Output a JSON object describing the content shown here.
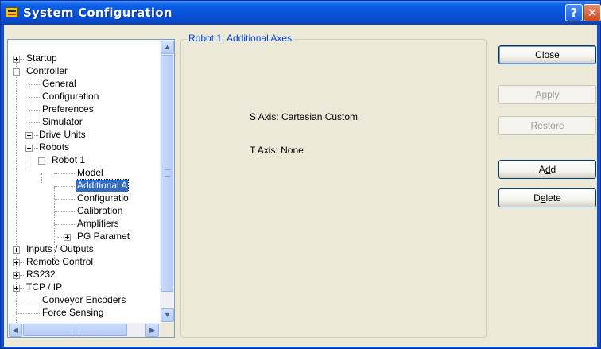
{
  "window": {
    "title": "System Configuration",
    "help_glyph": "?",
    "close_glyph": "✕"
  },
  "tree": {
    "nodes": [
      {
        "label": "Startup",
        "expander": "plus"
      },
      {
        "label": "Controller",
        "expander": "minus"
      },
      {
        "label": "General"
      },
      {
        "label": "Configuration"
      },
      {
        "label": "Preferences"
      },
      {
        "label": "Simulator"
      },
      {
        "label": "Drive Units",
        "expander": "plus"
      },
      {
        "label": "Robots",
        "expander": "minus"
      },
      {
        "label": "Robot 1",
        "expander": "minus"
      },
      {
        "label": "Model"
      },
      {
        "label": "Additional A",
        "selected": true
      },
      {
        "label": "Configuratio"
      },
      {
        "label": "Calibration"
      },
      {
        "label": "Amplifiers"
      },
      {
        "label": "PG Paramet",
        "expander": "plus"
      },
      {
        "label": "Inputs / Outputs",
        "expander": "plus"
      },
      {
        "label": "Remote Control",
        "expander": "plus"
      },
      {
        "label": "RS232",
        "expander": "plus"
      },
      {
        "label": "TCP / IP",
        "expander": "plus"
      },
      {
        "label": "Conveyor Encoders"
      },
      {
        "label": "Force Sensing"
      }
    ],
    "scroll_up_glyph": "▲",
    "scroll_down_glyph": "▼",
    "scroll_left_glyph": "◀",
    "scroll_right_glyph": "▶"
  },
  "group": {
    "title": "Robot 1: Additional Axes",
    "s_axis": "S Axis: Cartesian Custom",
    "t_axis": "T Axis: None"
  },
  "buttons": {
    "close": {
      "label": "Close",
      "enabled": true
    },
    "apply": {
      "pre": "",
      "mnemonic": "A",
      "post": "pply",
      "enabled": false
    },
    "restore": {
      "pre": "",
      "mnemonic": "R",
      "post": "estore",
      "enabled": false
    },
    "add": {
      "pre": "A",
      "mnemonic": "d",
      "post": "d",
      "enabled": true
    },
    "delete": {
      "pre": "D",
      "mnemonic": "e",
      "post": "lete",
      "enabled": true
    }
  },
  "colors": {
    "titlebar": "#0a5fe8",
    "selection": "#316ac5",
    "group_title": "#0046d5",
    "dialog_bg": "#ece9d8"
  }
}
